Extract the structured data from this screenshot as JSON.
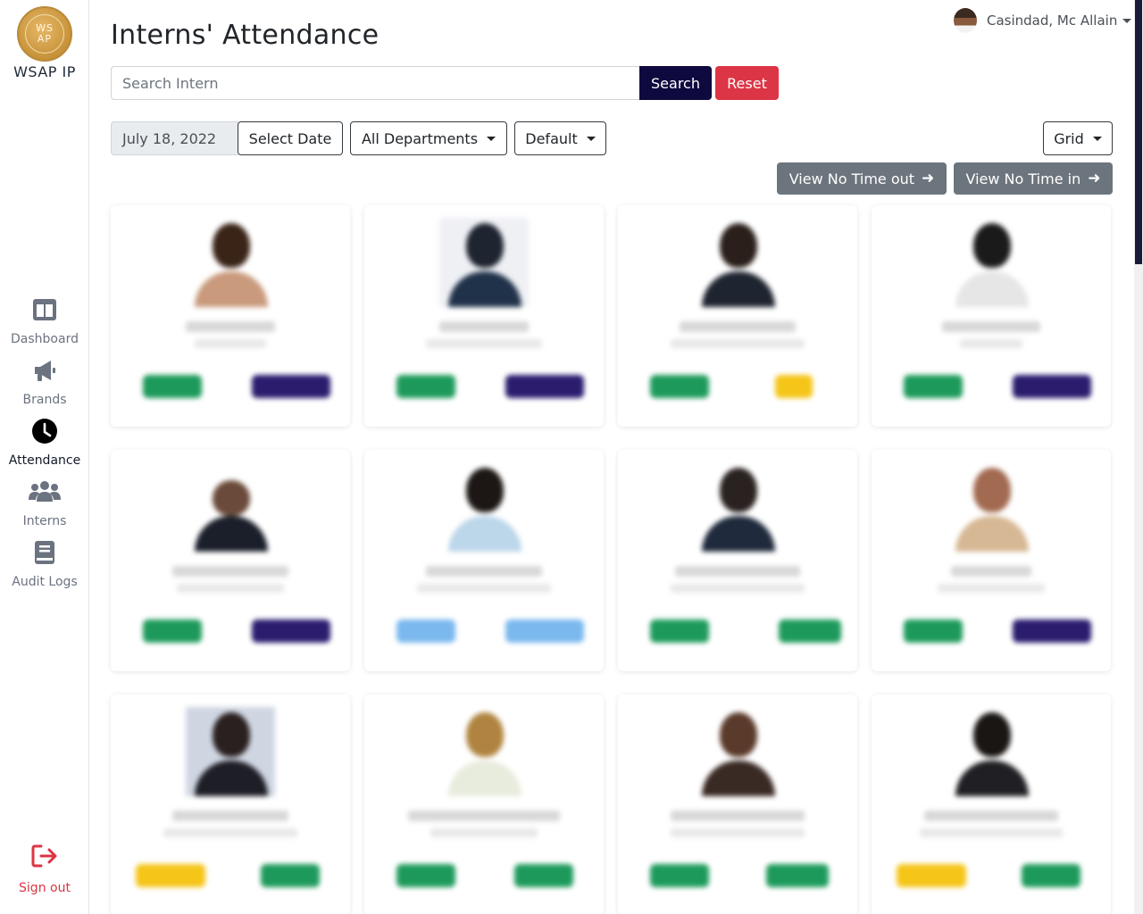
{
  "app": {
    "logo_top": "WS",
    "logo_bottom": "AP",
    "name": "WSAP IP"
  },
  "sidebar": {
    "items": [
      {
        "label": "Dashboard",
        "icon": "dashboard-icon"
      },
      {
        "label": "Brands",
        "icon": "megaphone-icon"
      },
      {
        "label": "Attendance",
        "icon": "clock-icon",
        "active": true
      },
      {
        "label": "Interns",
        "icon": "users-icon"
      },
      {
        "label": "Audit Logs",
        "icon": "book-icon"
      }
    ],
    "signout_label": "Sign out"
  },
  "header": {
    "title": "Interns' Attendance",
    "user_name": "Casindad, Mc Allain"
  },
  "search": {
    "placeholder": "Search Intern",
    "search_label": "Search",
    "reset_label": "Reset"
  },
  "filters": {
    "date_value": "July 18, 2022",
    "select_date_label": "Select Date",
    "department_label": "All Departments",
    "sort_label": "Default",
    "view_label": "Grid",
    "no_time_out_label": "View No Time out",
    "no_time_in_label": "View No Time in"
  },
  "colors": {
    "primary_dark": "#0e0a3f",
    "danger": "#dc3545",
    "secondary": "#6c757d",
    "time_in_green": "#1d9a5b",
    "time_out_indigo": "#2b1c6e",
    "late_yellow": "#f5c518",
    "light_blue": "#7ab8ee"
  }
}
